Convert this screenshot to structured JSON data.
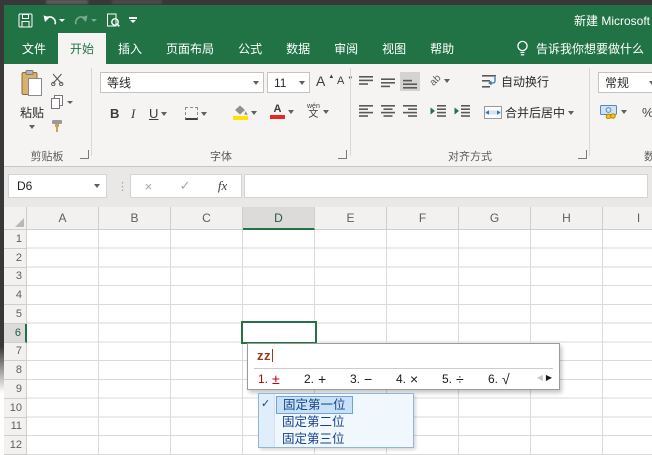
{
  "titlebar": {
    "title": "新建 Microsoft"
  },
  "tabs": {
    "items": [
      "文件",
      "开始",
      "插入",
      "页面布局",
      "公式",
      "数据",
      "审阅",
      "视图",
      "帮助"
    ],
    "tellme": "告诉我你想要做什么"
  },
  "ribbon": {
    "clipboard": {
      "paste": "粘贴",
      "label": "剪贴板"
    },
    "font": {
      "name": "等线",
      "size": "11",
      "bold": "B",
      "italic": "I",
      "underline": "U",
      "grow": "A",
      "shrink": "A",
      "phonetic_top": "wén",
      "phonetic": "文",
      "label": "字体"
    },
    "align": {
      "wrap": "自动换行",
      "merge": "合并后居中",
      "label": "对齐方式"
    },
    "number": {
      "format": "常规",
      "percent": "%",
      "label": "数字"
    }
  },
  "formula": {
    "cell_ref": "D6",
    "cancel": "×",
    "enter": "✓",
    "fx": "fx",
    "value": ""
  },
  "sheet": {
    "cols": [
      "A",
      "B",
      "C",
      "D",
      "E",
      "F",
      "G",
      "H",
      "I"
    ],
    "rows": [
      "1",
      "2",
      "3",
      "4",
      "5",
      "6",
      "7",
      "8",
      "9",
      "10",
      "11",
      "12"
    ],
    "selected_cell": "D6"
  },
  "ime": {
    "composition": "zz",
    "candidates": [
      {
        "n": "1.",
        "s": "±"
      },
      {
        "n": "2.",
        "s": "+"
      },
      {
        "n": "3.",
        "s": "−"
      },
      {
        "n": "4.",
        "s": "×"
      },
      {
        "n": "5.",
        "s": "÷"
      },
      {
        "n": "6.",
        "s": "√"
      }
    ],
    "prev": "◀",
    "next": "▶"
  },
  "ime_menu": {
    "check": "✓",
    "items": [
      "固定第一位",
      "固定第二位",
      "固定第三位"
    ]
  },
  "colors": {
    "excel_green": "#217346",
    "candidate_red": "#c00000",
    "composition_red": "#9c3a20",
    "menu_blue": "#15428b"
  }
}
